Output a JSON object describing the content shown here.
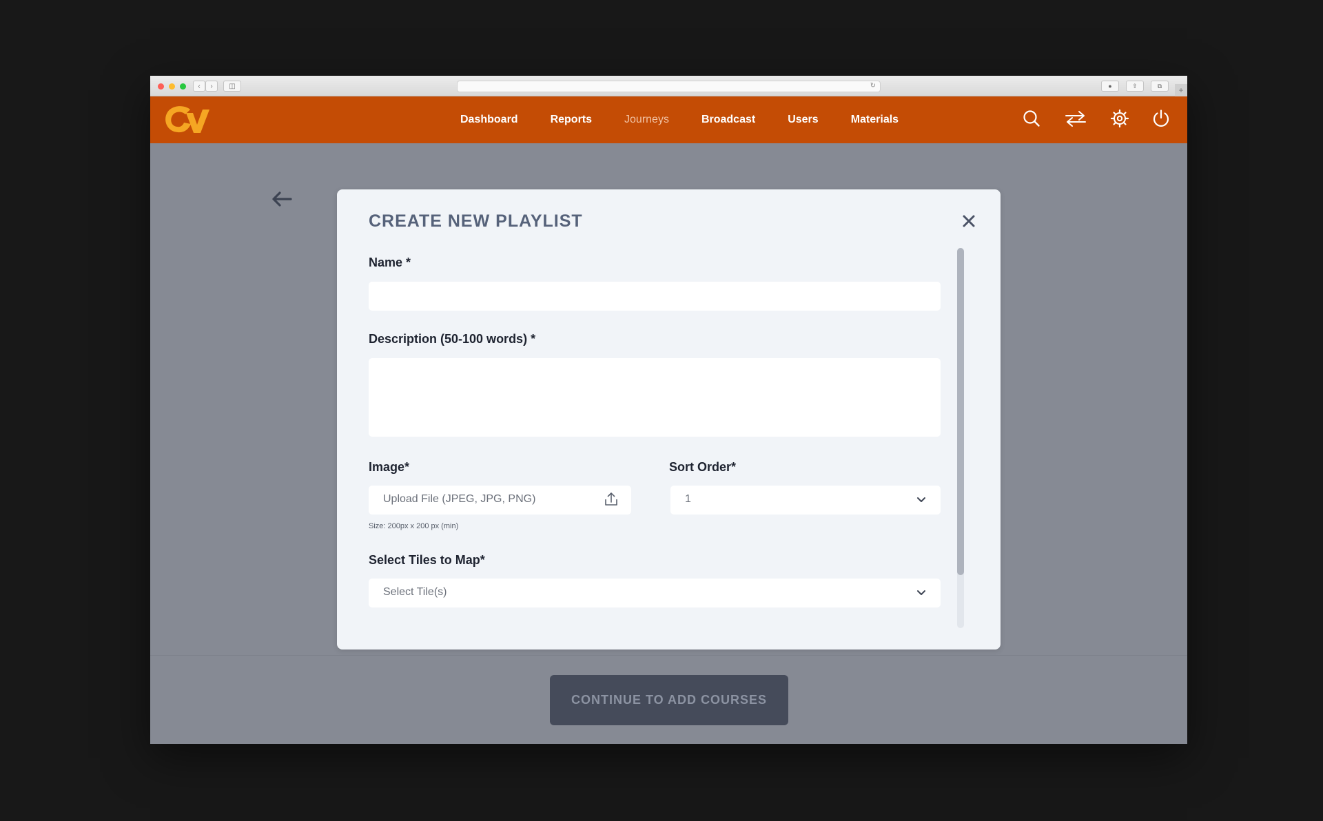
{
  "nav": {
    "items": [
      {
        "label": "Dashboard",
        "active": true
      },
      {
        "label": "Reports",
        "active": true
      },
      {
        "label": "Journeys",
        "active": false
      },
      {
        "label": "Broadcast",
        "active": true
      },
      {
        "label": "Users",
        "active": true
      },
      {
        "label": "Materials",
        "active": true
      }
    ],
    "icons": [
      "search-icon",
      "switch-icon",
      "gear-icon",
      "power-icon"
    ]
  },
  "colors": {
    "brand": "#c44c05",
    "logo": "#f5a623",
    "overlay": "#868a94",
    "modal_bg": "#f1f4f8",
    "button_bg": "#454b5a"
  },
  "modal": {
    "title": "CREATE NEW PLAYLIST",
    "name": {
      "label": "Name *",
      "value": "",
      "placeholder": ""
    },
    "description": {
      "label": "Description (50-100 words) *",
      "value": "",
      "placeholder": ""
    },
    "image": {
      "label": "Image*",
      "placeholder": "Upload File (JPEG, JPG, PNG)",
      "hint": "Size: 200px x 200 px (min)"
    },
    "sort_order": {
      "label": "Sort Order*",
      "value": "1"
    },
    "tiles": {
      "label": "Select Tiles to Map*",
      "placeholder": "Select Tile(s)"
    }
  },
  "footer": {
    "continue_label": "CONTINUE TO ADD COURSES"
  }
}
